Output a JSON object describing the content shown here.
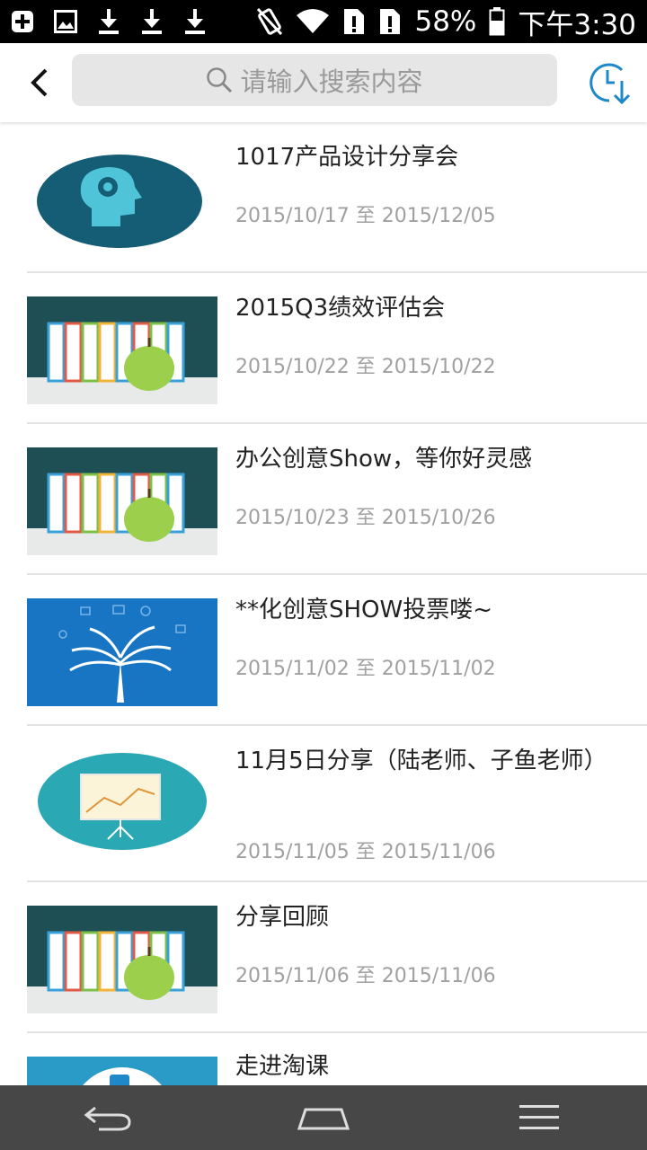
{
  "status_bar": {
    "battery": "58%",
    "time": "下午3:30"
  },
  "header": {
    "search_placeholder": "请输入搜索内容",
    "accent_color": "#1e88c8"
  },
  "items": [
    {
      "title": "1017产品设计分享会",
      "date": "2015/10/17 至 2015/12/05",
      "thumb": "head-gear-icon"
    },
    {
      "title": "2015Q3绩效评估会",
      "date": "2015/10/22 至 2015/10/22",
      "thumb": "books-apple-image"
    },
    {
      "title": "办公创意Show，等你好灵感",
      "date": "2015/10/23 至 2015/10/26",
      "thumb": "books-apple-image"
    },
    {
      "title": "**化创意SHOW投票喽~",
      "date": "2015/11/02 至 2015/11/02",
      "thumb": "idea-tree-image"
    },
    {
      "title": "11月5日分享（陆老师、子鱼老师）",
      "date": "2015/11/05 至 2015/11/06",
      "thumb": "presentation-board-icon"
    },
    {
      "title": "分享回顾",
      "date": "2015/11/06 至 2015/11/06",
      "thumb": "books-apple-image"
    },
    {
      "title": "走进淘课",
      "date": "",
      "thumb": "team-badge-image"
    }
  ]
}
